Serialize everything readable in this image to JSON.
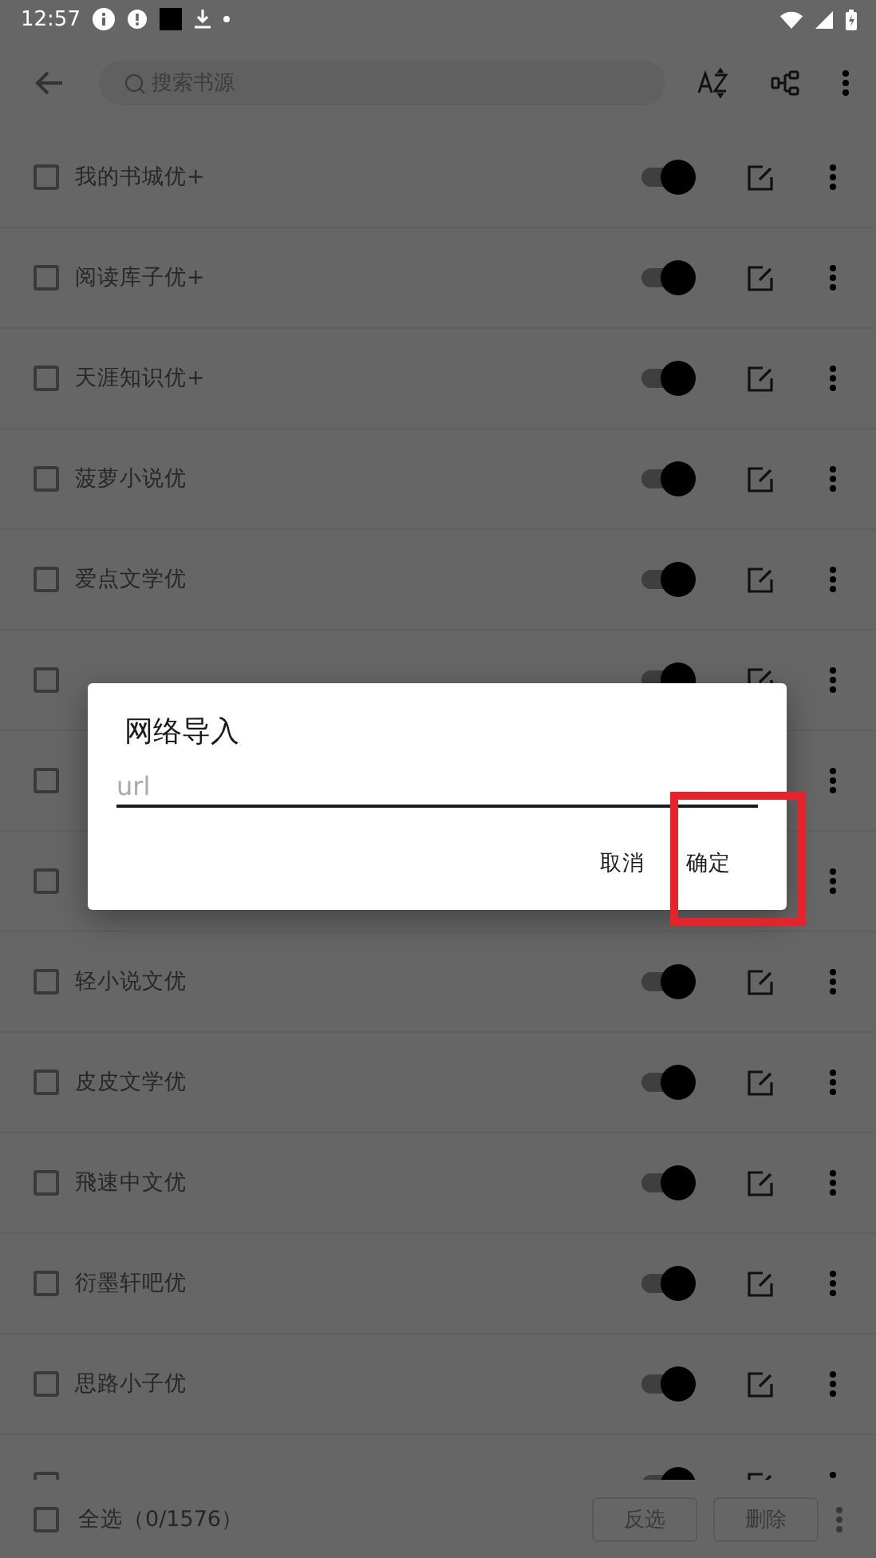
{
  "status_bar": {
    "time": "12:57"
  },
  "toolbar": {
    "search": {
      "placeholder": "搜索书源"
    }
  },
  "sources": [
    {
      "name": "我的书城优+",
      "checked": false,
      "enabled": true
    },
    {
      "name": "阅读库子优+",
      "checked": false,
      "enabled": true
    },
    {
      "name": "天涯知识优+",
      "checked": false,
      "enabled": true
    },
    {
      "name": "菠萝小说优",
      "checked": false,
      "enabled": true
    },
    {
      "name": "爱点文学优",
      "checked": false,
      "enabled": true
    },
    {
      "checked": false,
      "enabled": true
    },
    {
      "checked": false
    },
    {
      "checked": false
    },
    {
      "name": "轻小说文优",
      "checked": false,
      "enabled": true
    },
    {
      "name": "皮皮文学优",
      "checked": false,
      "enabled": true
    },
    {
      "name": "飛速中文优",
      "checked": false,
      "enabled": true
    },
    {
      "name": "衍墨轩吧优",
      "checked": false,
      "enabled": true
    },
    {
      "name": "思路小子优",
      "checked": false,
      "enabled": true
    },
    {
      "checked": false,
      "enabled": true
    }
  ],
  "footer": {
    "select_all": {
      "label": "全选（0/1576）",
      "checked": false
    },
    "buttons": [
      {
        "label": "反选",
        "disabled": true
      },
      {
        "label": "删除",
        "disabled": true
      }
    ]
  },
  "dialog": {
    "title": "网络导入",
    "url_field": {
      "placeholder": "url"
    },
    "buttons": [
      {
        "label": "取消",
        "highlighted": false
      },
      {
        "label": "确定",
        "highlighted": true
      }
    ]
  }
}
